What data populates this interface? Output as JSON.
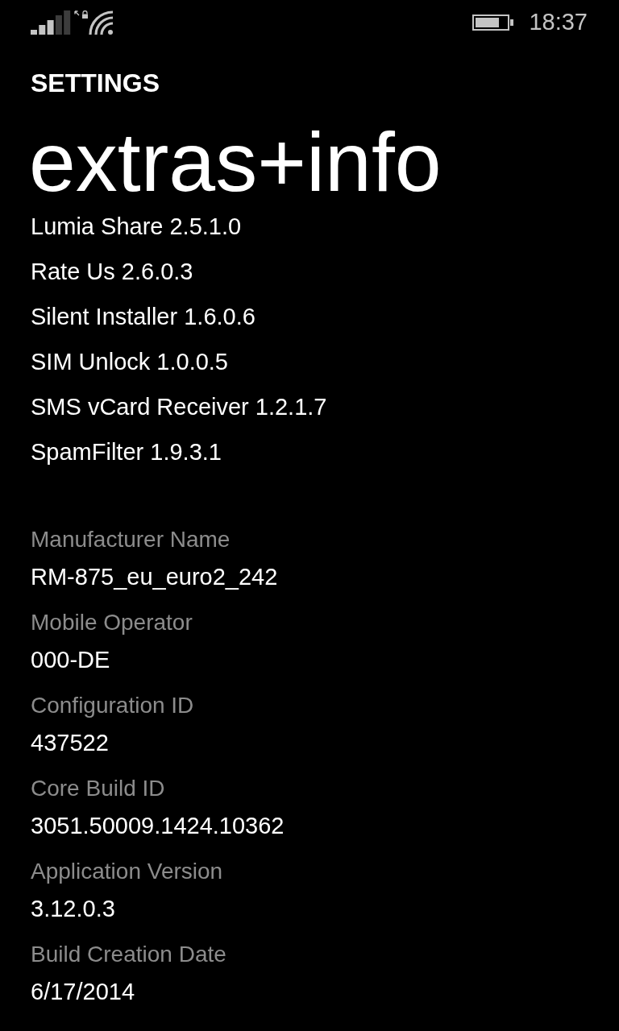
{
  "status_bar": {
    "time": "18:37"
  },
  "header": {
    "section": "SETTINGS",
    "title": "extras+info"
  },
  "apps": [
    "Lumia Share 2.5.1.0",
    "Rate Us 2.6.0.3",
    "Silent Installer 1.6.0.6",
    "SIM Unlock 1.0.0.5",
    "SMS vCard Receiver 1.2.1.7",
    "SpamFilter 1.9.3.1"
  ],
  "details": [
    {
      "label": "Manufacturer Name",
      "value": "RM-875_eu_euro2_242"
    },
    {
      "label": "Mobile Operator",
      "value": "000-DE"
    },
    {
      "label": "Configuration ID",
      "value": "437522"
    },
    {
      "label": "Core Build ID",
      "value": "3051.50009.1424.10362"
    },
    {
      "label": "Application Version",
      "value": "3.12.0.3"
    },
    {
      "label": "Build Creation Date",
      "value": "6/17/2014"
    }
  ]
}
